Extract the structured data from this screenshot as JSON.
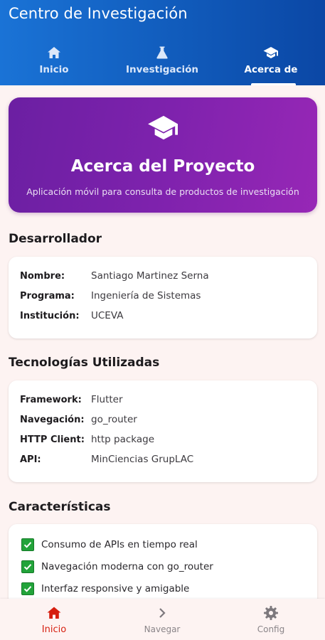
{
  "app": {
    "title": "Centro de Investigación"
  },
  "tabs": [
    {
      "label": "Inicio",
      "icon": "home-icon"
    },
    {
      "label": "Investigación",
      "icon": "flask-icon"
    },
    {
      "label": "Acerca de",
      "icon": "graduation-cap-icon",
      "active": true
    }
  ],
  "hero": {
    "icon": "graduation-cap-icon",
    "title": "Acerca del Proyecto",
    "subtitle": "Aplicación móvil para consulta de productos de investigación"
  },
  "developer": {
    "heading": "Desarrollador",
    "rows": [
      {
        "label": "Nombre:",
        "value": "Santiago Martinez Serna"
      },
      {
        "label": "Programa:",
        "value": "Ingeniería de Sistemas"
      },
      {
        "label": "Institución:",
        "value": "UCEVA"
      }
    ]
  },
  "technologies": {
    "heading": "Tecnologías Utilizadas",
    "rows": [
      {
        "label": "Framework:",
        "value": "Flutter"
      },
      {
        "label": "Navegación:",
        "value": "go_router"
      },
      {
        "label": "HTTP Client:",
        "value": "http package"
      },
      {
        "label": "API:",
        "value": "MinCiencias GrupLAC"
      }
    ]
  },
  "features": {
    "heading": "Características",
    "items": [
      "Consumo de APIs en tiempo real",
      "Navegación moderna con go_router",
      "Interfaz responsive y amigable"
    ]
  },
  "bottom_nav": [
    {
      "label": "Inicio",
      "icon": "home-icon",
      "active": true
    },
    {
      "label": "Navegar",
      "icon": "chevron-right-icon"
    },
    {
      "label": "Config",
      "icon": "gear-icon"
    }
  ],
  "colors": {
    "appbar": "#1a73d6",
    "hero": "#7e22ad",
    "active_nav": "#d61f10",
    "check": "#22a33a"
  }
}
